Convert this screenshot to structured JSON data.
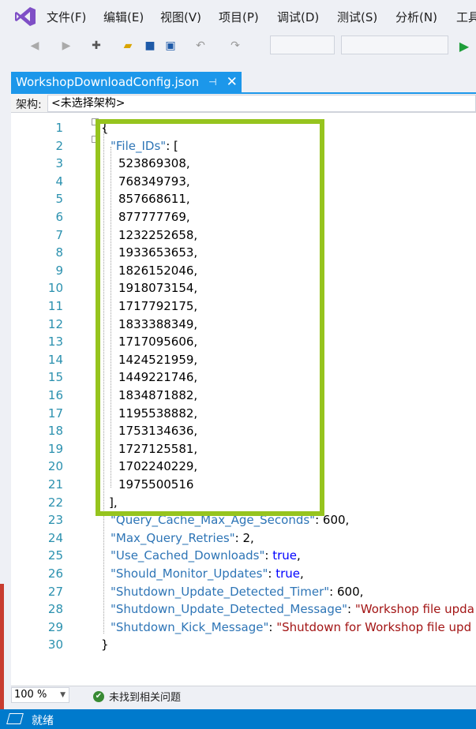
{
  "menu": {
    "items": [
      "文件(F)",
      "编辑(E)",
      "视图(V)",
      "项目(P)",
      "调试(D)",
      "测试(S)",
      "分析(N)",
      "工具"
    ]
  },
  "toolbar": {
    "icons": [
      "back-icon",
      "forward-icon",
      "new-item-icon",
      "open-folder-icon",
      "save-icon",
      "save-all-icon",
      "undo-icon",
      "redo-icon",
      "start-icon"
    ]
  },
  "tab": {
    "title": "WorkshopDownloadConfig.json",
    "pin": "⊣",
    "close": "✕"
  },
  "navbar": {
    "label": "架构:",
    "value": "<未选择架构>"
  },
  "editor": {
    "line_numbers": [
      "1",
      "2",
      "3",
      "4",
      "5",
      "6",
      "7",
      "8",
      "9",
      "10",
      "11",
      "12",
      "13",
      "14",
      "15",
      "16",
      "17",
      "18",
      "19",
      "20",
      "21",
      "22",
      "23",
      "24",
      "25",
      "26",
      "27",
      "28",
      "29",
      "30"
    ],
    "open_brace": "{",
    "close_brace": "}",
    "file_ids_key": "\"File_IDs\"",
    "file_ids_open": ": [",
    "file_ids": [
      "523869308,",
      "768349793,",
      "857668611,",
      "877777769,",
      "1232252658,",
      "1933653653,",
      "1826152046,",
      "1918073154,",
      "1717792175,",
      "1833388349,",
      "1717095606,",
      "1424521959,",
      "1449221746,",
      "1834871882,",
      "1195538882,",
      "1753134636,",
      "1727125581,",
      "1702240229,",
      "1975500516"
    ],
    "file_ids_close": "],",
    "props": [
      {
        "key": "\"Query_Cache_Max_Age_Seconds\"",
        "sep": ": ",
        "value": "600,",
        "type": "num"
      },
      {
        "key": "\"Max_Query_Retries\"",
        "sep": ": ",
        "value": "2,",
        "type": "num"
      },
      {
        "key": "\"Use_Cached_Downloads\"",
        "sep": ": ",
        "value": "true",
        "tail": ",",
        "type": "kw"
      },
      {
        "key": "\"Should_Monitor_Updates\"",
        "sep": ": ",
        "value": "true",
        "tail": ",",
        "type": "kw"
      },
      {
        "key": "\"Shutdown_Update_Detected_Timer\"",
        "sep": ": ",
        "value": "600,",
        "type": "num"
      },
      {
        "key": "\"Shutdown_Update_Detected_Message\"",
        "sep": ": ",
        "value": "\"Workshop file upda",
        "type": "str"
      },
      {
        "key": "\"Shutdown_Kick_Message\"",
        "sep": ": ",
        "value": "\"Shutdown for Workshop file upd",
        "type": "str"
      }
    ]
  },
  "zoom": "100 %",
  "issues": "未找到相关问题",
  "status": "就绪",
  "colors": {
    "accent": "#1c97ea",
    "highlight": "#96c41e",
    "status_bar": "#007acc"
  }
}
